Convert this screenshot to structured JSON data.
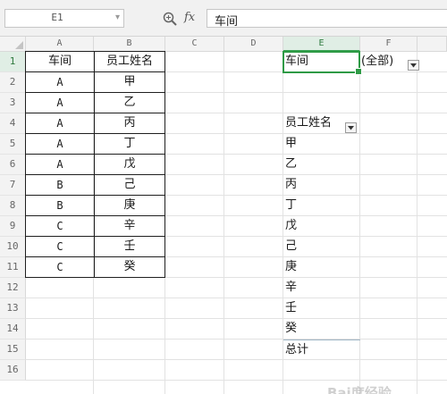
{
  "name_box": {
    "value": "E1"
  },
  "formula_bar": {
    "fx_label": "fx",
    "content": "车间"
  },
  "columns": [
    "A",
    "B",
    "C",
    "D",
    "E",
    "F"
  ],
  "rows": [
    "1",
    "2",
    "3",
    "4",
    "5",
    "6",
    "7",
    "8",
    "9",
    "10",
    "11",
    "12",
    "13",
    "14",
    "15",
    "16"
  ],
  "source_table": {
    "headers": [
      "车间",
      "员工姓名"
    ],
    "rows": [
      [
        "A",
        "甲"
      ],
      [
        "A",
        "乙"
      ],
      [
        "A",
        "丙"
      ],
      [
        "A",
        "丁"
      ],
      [
        "A",
        "戊"
      ],
      [
        "B",
        "己"
      ],
      [
        "B",
        "庚"
      ],
      [
        "C",
        "辛"
      ],
      [
        "C",
        "壬"
      ],
      [
        "C",
        "癸"
      ]
    ]
  },
  "pivot": {
    "filter_field": "车间",
    "filter_value": "(全部)",
    "row_field": "员工姓名",
    "items": [
      "甲",
      "乙",
      "丙",
      "丁",
      "戊",
      "己",
      "庚",
      "辛",
      "壬",
      "癸"
    ],
    "total_label": "总计"
  },
  "selection": {
    "cell": "E1",
    "color": "#2e9a45"
  },
  "watermark": "Bai度经验"
}
